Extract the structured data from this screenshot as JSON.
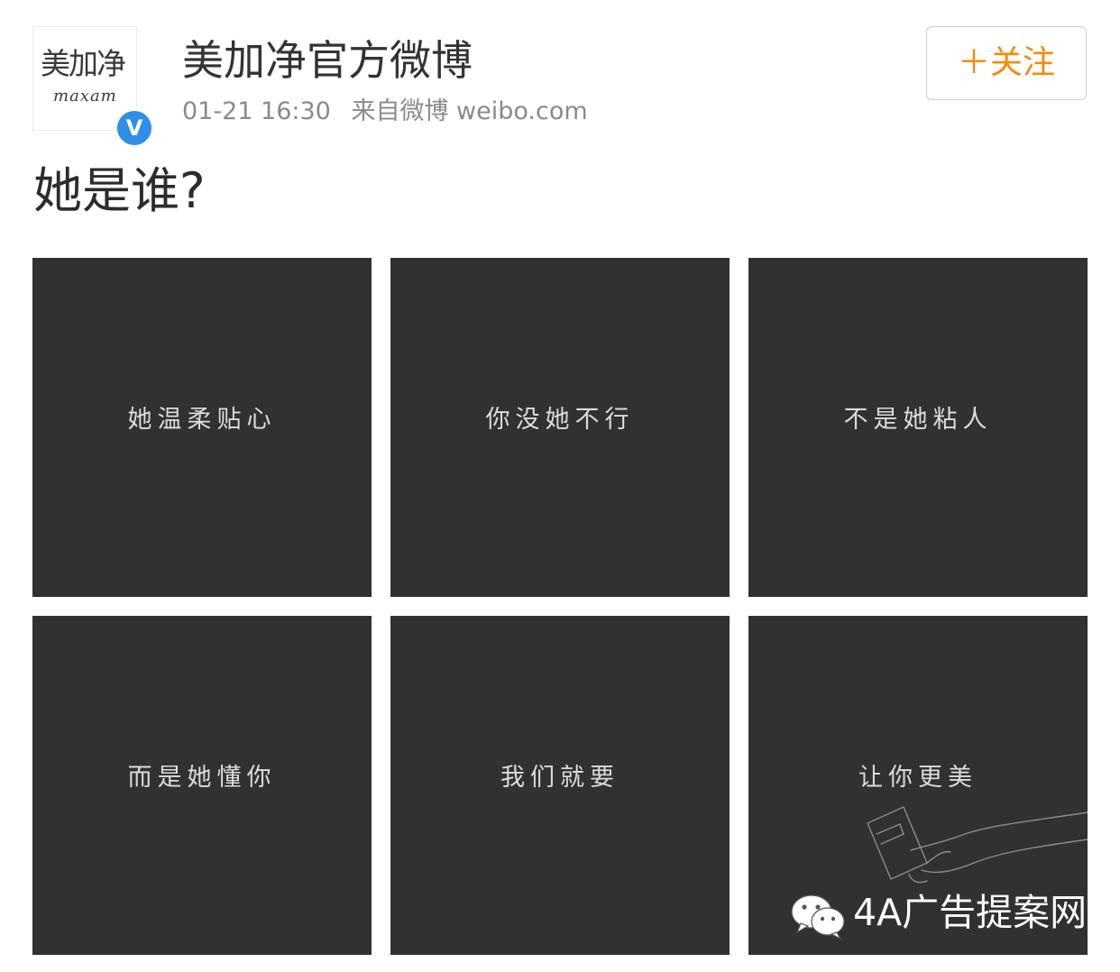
{
  "author": {
    "name": "美加净官方微博",
    "avatar_logo_cn": "美加净",
    "avatar_logo_en": "maxam",
    "verified_badge": "V"
  },
  "meta": {
    "time": "01-21 16:30",
    "source": "来自微博 weibo.com"
  },
  "follow_button": "＋关注",
  "post_text": "她是谁?",
  "images": [
    {
      "text": "她温柔贴心"
    },
    {
      "text": "你没她不行"
    },
    {
      "text": "不是她粘人"
    },
    {
      "text": "而是她懂你"
    },
    {
      "text": "我们就要"
    },
    {
      "text": "让你更美"
    }
  ],
  "watermark": {
    "icon": "wechat-icon",
    "text": "4A广告提案网"
  },
  "colors": {
    "accent": "#f28c10",
    "verified": "#2f8fe8",
    "tile_background": "#303131"
  }
}
